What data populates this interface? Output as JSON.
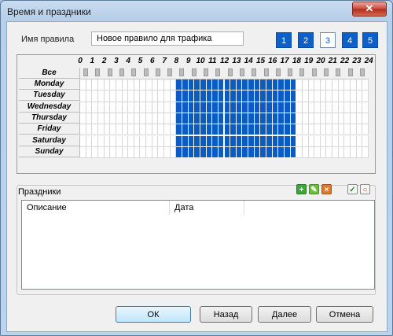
{
  "window": {
    "title": "Время и праздники",
    "close_glyph": "✕"
  },
  "rule": {
    "label": "Имя правила",
    "value": "Новое правило для трафика"
  },
  "pages": [
    "1",
    "2",
    "3",
    "4",
    "5"
  ],
  "selected_page": "3",
  "schedule": {
    "all_label": "Все",
    "hours": [
      "0",
      "1",
      "2",
      "3",
      "4",
      "5",
      "6",
      "7",
      "8",
      "9",
      "10",
      "11",
      "12",
      "13",
      "14",
      "15",
      "16",
      "17",
      "18",
      "19",
      "20",
      "21",
      "22",
      "23",
      "24"
    ],
    "days": [
      "Monday",
      "Tuesday",
      "Wednesday",
      "Thursday",
      "Friday",
      "Saturday",
      "Sunday"
    ],
    "active_from_hour": 8,
    "active_to_hour": 18,
    "active_color": "#0a5bc4"
  },
  "holidays": {
    "title": "Праздники",
    "columns": [
      "Описание",
      "Дата",
      ""
    ],
    "rows": [],
    "tool_icons": [
      "add-icon",
      "edit-icon",
      "delete-icon",
      "check-all-icon",
      "uncheck-icon"
    ]
  },
  "buttons": {
    "ok": "ОК",
    "back": "Назад",
    "next": "Далее",
    "cancel": "Отмена"
  }
}
